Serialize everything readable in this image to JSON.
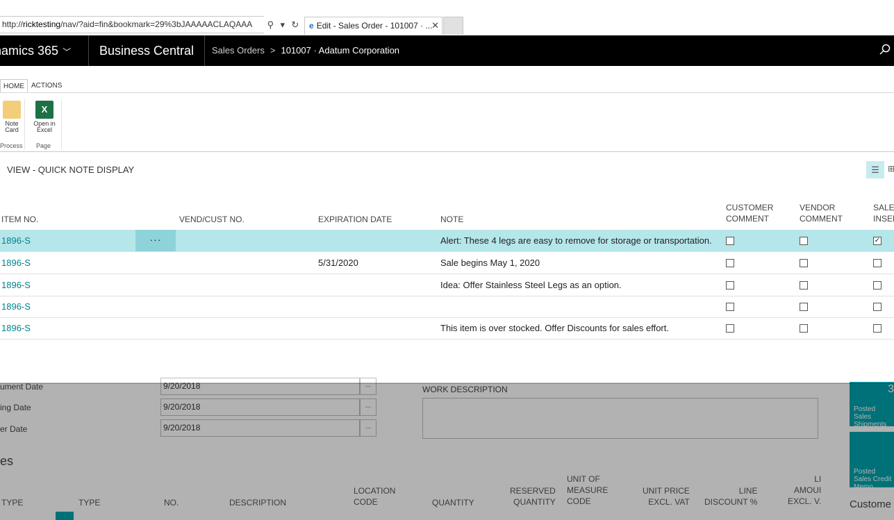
{
  "browser": {
    "url_prefix": "http://",
    "url_host": "ricktesting",
    "url_path": "/nav/?aid=fin&bookmark=29%3bJAAAAACLAQAAA",
    "tab_title": "Edit - Sales Order - 101007 · ...",
    "search_icon": "⚲",
    "dropdown_icon": "▾",
    "refresh_icon": "↻",
    "close_icon": "✕",
    "ie_icon": "e"
  },
  "appbar": {
    "brand": "namics 365",
    "brand_chevron": "﹀",
    "product": "Business Central",
    "crumb_1": "Sales Orders",
    "crumb_sep": ">",
    "crumb_2": "101007 · Adatum Corporation",
    "search_icon": "🔍"
  },
  "ribbon": {
    "tabs": [
      "HOME",
      "ACTIONS"
    ],
    "note_card_line1": "Note",
    "note_card_line2": "Card",
    "open_excel_line1": "Open in",
    "open_excel_line2": "Excel",
    "excel_glyph": "X",
    "group_process": "Process",
    "group_page": "Page"
  },
  "view": {
    "title": "VIEW - QUICK NOTE DISPLAY",
    "list_icon": "☰",
    "card_icon": "⊞"
  },
  "table": {
    "headers": {
      "item_no": "ITEM NO.",
      "vend_cust": "VEND/CUST NO.",
      "expiration": "EXPIRATION DATE",
      "note": "NOTE",
      "customer_comment_1": "CUSTOMER",
      "customer_comment_2": "COMMENT",
      "vendor_comment_1": "VENDOR",
      "vendor_comment_2": "COMMENT",
      "sales_insert_1": "SALES",
      "sales_insert_2": "INSERT"
    },
    "rows": [
      {
        "item_no": "1896-S",
        "vend_cust": "",
        "expiration": "",
        "note": "Alert: These 4 legs are easy to remove for storage or transportation.",
        "customer": false,
        "vendor": false,
        "sales": true
      },
      {
        "item_no": "1896-S",
        "vend_cust": "",
        "expiration": "5/31/2020",
        "note": "Sale begins May 1, 2020",
        "customer": false,
        "vendor": false,
        "sales": false
      },
      {
        "item_no": "1896-S",
        "vend_cust": "",
        "expiration": "",
        "note": "Idea: Offer Stainless Steel Legs as an option.",
        "customer": false,
        "vendor": false,
        "sales": false
      },
      {
        "item_no": "1896-S",
        "vend_cust": "",
        "expiration": "",
        "note": "",
        "customer": false,
        "vendor": false,
        "sales": false
      },
      {
        "item_no": "1896-S",
        "vend_cust": "",
        "expiration": "",
        "note": "This item is over stocked. Offer Discounts for sales effort.",
        "customer": false,
        "vendor": false,
        "sales": false
      }
    ],
    "row_menu": "···",
    "check_mark": "✓"
  },
  "background": {
    "document_date_label": "ument Date",
    "posting_date_label": "ing Date",
    "order_date_label": "er Date",
    "document_date": "9/20/2018",
    "posting_date": "9/20/2018",
    "order_date": "9/20/2018",
    "lookup": "...",
    "work_description": "WORK DESCRIPTION",
    "lines_title": "es",
    "tile_1": "Posted Sales Shipments",
    "tile_1_count": "3",
    "tile_2": "Posted Sales Credit Memo",
    "customer_label": "Custome",
    "lines_headers": {
      "type1": "TYPE",
      "type2": "TYPE",
      "no": "NO.",
      "description": "DESCRIPTION",
      "location_1": "LOCATION",
      "location_2": "CODE",
      "quantity": "QUANTITY",
      "reserved_1": "RESERVED",
      "reserved_2": "QUANTITY",
      "uom_1": "UNIT OF",
      "uom_2": "MEASURE",
      "uom_3": "CODE",
      "price_1": "UNIT PRICE",
      "price_2": "EXCL. VAT",
      "discount_1": "LINE",
      "discount_2": "DISCOUNT %",
      "amount_1": "LI",
      "amount_2": "AMOUI",
      "amount_3": "EXCL. V."
    }
  }
}
